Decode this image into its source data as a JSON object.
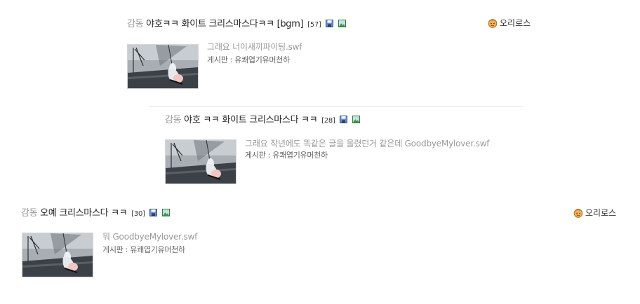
{
  "posts": [
    {
      "category": "감동",
      "title": "야호ㅋㅋ 화이트 크리스마스다ㅋㅋ [bgm]",
      "comment_count": "[57]",
      "description": "그래요 너이새끼파이팅.swf",
      "board": "게시판 : 유쾌엽기유머천하",
      "author": "오리로스",
      "icons": [
        "save-icon",
        "image-icon"
      ]
    },
    {
      "category": "감동",
      "title": "야호 ㅋㅋ 화이트 크리스마스다 ㅋㅋ",
      "comment_count": "[28]",
      "description": "그래요 작년에도 똑같은 글을 올렸던거 같은데 GoodbyeMylover.swf",
      "board": "게시판 : 유쾌엽기유머천하",
      "icons": [
        "save-icon",
        "image-icon"
      ]
    },
    {
      "category": "감동",
      "title": "오예 크리스마스다 ㅋㅋ",
      "comment_count": "[30]",
      "description": "뭐 GoodbyeMylover.swf",
      "board": "게시판 : 유쾌엽기유머천하",
      "author": "오리로스",
      "icons": [
        "save-icon",
        "image-icon"
      ]
    }
  ],
  "colors": {
    "category": "#999999",
    "title": "#222222",
    "description": "#999999",
    "board": "#666666",
    "divider": "#e4e4e4"
  }
}
